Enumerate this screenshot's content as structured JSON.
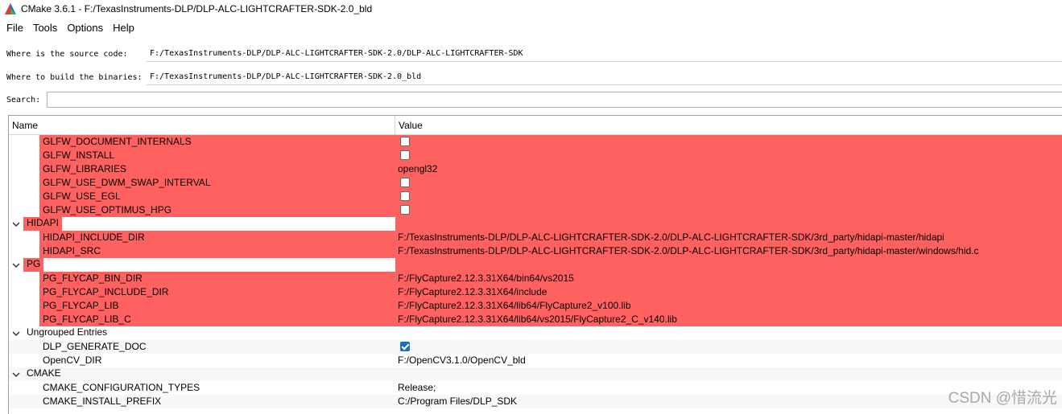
{
  "window": {
    "title": "CMake 3.6.1 - F:/TexasInstruments-DLP/DLP-ALC-LIGHTCRAFTER-SDK-2.0_bld"
  },
  "menu": {
    "items": [
      "File",
      "Tools",
      "Options",
      "Help"
    ]
  },
  "paths": {
    "source_label": "Where is the source code:",
    "source_value": "F:/TexasInstruments-DLP/DLP-ALC-LIGHTCRAFTER-SDK-2.0/DLP-ALC-LIGHTCRAFTER-SDK",
    "build_label": "Where to build the binaries:",
    "build_value": "F:/TexasInstruments-DLP/DLP-ALC-LIGHTCRAFTER-SDK-2.0_bld",
    "search_label": "Search:",
    "search_value": ""
  },
  "grid": {
    "header_name": "Name",
    "header_value": "Value",
    "glfw_entries": [
      {
        "name": "GLFW_DOCUMENT_INTERNALS",
        "type": "checkbox",
        "checked": false
      },
      {
        "name": "GLFW_INSTALL",
        "type": "checkbox",
        "checked": false
      },
      {
        "name": "GLFW_LIBRARIES",
        "type": "text",
        "value": "opengl32"
      },
      {
        "name": "GLFW_USE_DWM_SWAP_INTERVAL",
        "type": "checkbox",
        "checked": false
      },
      {
        "name": "GLFW_USE_EGL",
        "type": "checkbox",
        "checked": false
      },
      {
        "name": "GLFW_USE_OPTIMUS_HPG",
        "type": "checkbox",
        "checked": false
      }
    ],
    "hidapi": {
      "label": "HIDAPI",
      "entries": [
        {
          "name": "HIDAPI_INCLUDE_DIR",
          "value": "F:/TexasInstruments-DLP/DLP-ALC-LIGHTCRAFTER-SDK-2.0/DLP-ALC-LIGHTCRAFTER-SDK/3rd_party/hidapi-master/hidapi"
        },
        {
          "name": "HIDAPI_SRC",
          "value": "F:/TexasInstruments-DLP/DLP-ALC-LIGHTCRAFTER-SDK-2.0/DLP-ALC-LIGHTCRAFTER-SDK/3rd_party/hidapi-master/windows/hid.c"
        }
      ]
    },
    "pg": {
      "label": "PG",
      "entries": [
        {
          "name": "PG_FLYCAP_BIN_DIR",
          "value": "F:/FlyCapture2.12.3.31X64/bin64/vs2015"
        },
        {
          "name": "PG_FLYCAP_INCLUDE_DIR",
          "value": "F:/FlyCapture2.12.3.31X64/include"
        },
        {
          "name": "PG_FLYCAP_LIB",
          "value": "F:/FlyCapture2.12.3.31X64/lib64/FlyCapture2_v100.lib"
        },
        {
          "name": "PG_FLYCAP_LIB_C",
          "value": "F:/FlyCapture2.12.3.31X64/lib64/vs2015/FlyCapture2_C_v140.lib"
        }
      ]
    },
    "ungrouped": {
      "label": "Ungrouped Entries",
      "entries": [
        {
          "name": "DLP_GENERATE_DOC",
          "type": "checkbox",
          "checked": true
        },
        {
          "name": "OpenCV_DIR",
          "type": "text",
          "value": "F:/OpenCV3.1.0/OpenCV_bld"
        }
      ]
    },
    "cmake": {
      "label": "CMAKE",
      "entries": [
        {
          "name": "CMAKE_CONFIGURATION_TYPES",
          "value": "Release;"
        },
        {
          "name": "CMAKE_INSTALL_PREFIX",
          "value": "C:/Program Files/DLP_SDK"
        }
      ]
    }
  },
  "watermark": "CSDN @惜流光",
  "colors": {
    "changed_row": "#ff6161",
    "checkbox_on": "#1a6fc4"
  },
  "icons": {
    "expand": "chevron-down-icon",
    "app": "cmake-logo-icon"
  }
}
